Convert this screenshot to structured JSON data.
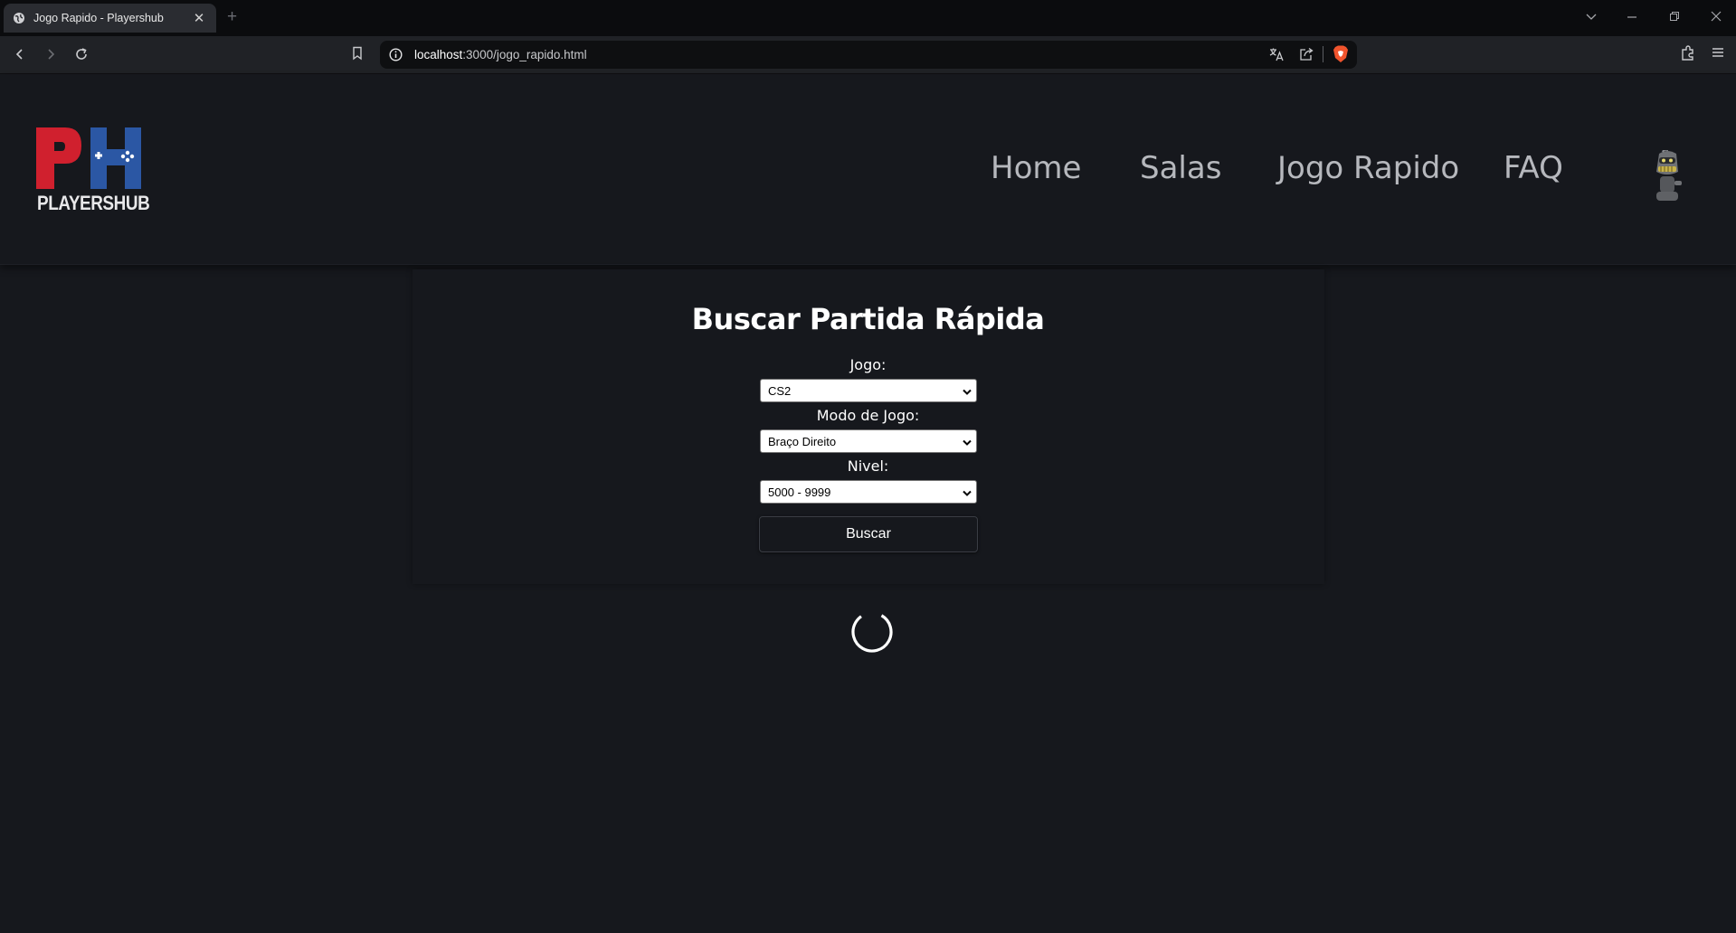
{
  "browser": {
    "tab_title": "Jogo Rapido - Playershub",
    "tab_close": "✕",
    "new_tab": "+",
    "url_host": "localhost",
    "url_path": ":3000/jogo_rapido.html"
  },
  "site": {
    "logo_text": "PLAYERSHUB",
    "nav": [
      "Home",
      "Salas",
      "Jogo Rapido",
      "FAQ"
    ]
  },
  "form": {
    "title": "Buscar Partida Rápida",
    "game_label": "Jogo:",
    "game_value": "CS2",
    "mode_label": "Modo de Jogo:",
    "mode_value": "Braço Direito",
    "level_label": "Nivel:",
    "level_value": "5000 - 9999",
    "search_button": "Buscar"
  },
  "colors": {
    "background": "#16181d",
    "logo_red": "#d0202e",
    "logo_blue": "#2b57a4",
    "nav_text": "#b6b8bd"
  }
}
